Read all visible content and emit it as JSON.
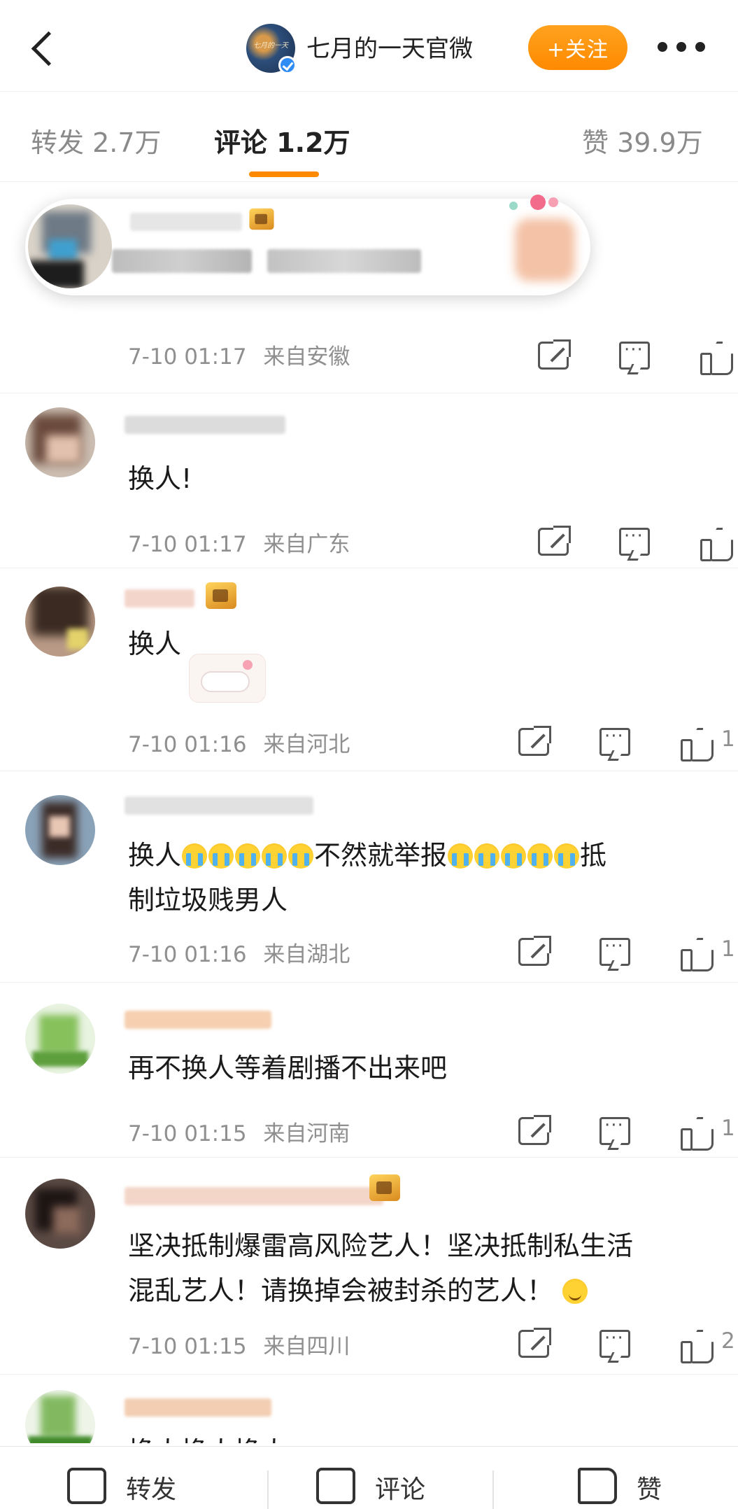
{
  "header": {
    "account_name": "七月的一天官微",
    "follow_label": "+关注",
    "avatar_glyph": "七月的一天"
  },
  "tabs": [
    {
      "label": "转发 2.7万",
      "active": false
    },
    {
      "label": "评论 1.2万",
      "active": true
    },
    {
      "label": "赞 39.9万",
      "active": false
    }
  ],
  "comments": [
    {
      "text": "",
      "time": "7-10 01:17",
      "location": "来自安徽",
      "likes": ""
    },
    {
      "text": "换人!",
      "time": "7-10 01:17",
      "location": "来自广东",
      "likes": ""
    },
    {
      "text": "换人",
      "time": "7-10 01:16",
      "location": "来自河北",
      "likes": "1"
    },
    {
      "text_a": "换人",
      "text_b": "不然就举报",
      "text_c": "抵",
      "text_d": "制垃圾贱男人",
      "time": "7-10 01:16",
      "location": "来自湖北",
      "likes": "1"
    },
    {
      "text": "再不换人等着剧播不出来吧",
      "time": "7-10 01:15",
      "location": "来自河南",
      "likes": "1"
    },
    {
      "text_a": "坚决抵制爆雷高风险艺人！坚决抵制私生活",
      "text_b": "混乱艺人！请换掉会被封杀的艺人！",
      "time": "7-10 01:15",
      "location": "来自四川",
      "likes": "2"
    },
    {
      "text": "换人换人换人",
      "time": "",
      "location": "",
      "likes": ""
    }
  ],
  "bottom_bar": {
    "repost_label": "转发",
    "comment_label": "评论",
    "like_label": "赞"
  },
  "colors": {
    "accent": "#ff8a00",
    "meta_text": "#8f8f8f",
    "verified_blue": "#2f8cf4"
  }
}
